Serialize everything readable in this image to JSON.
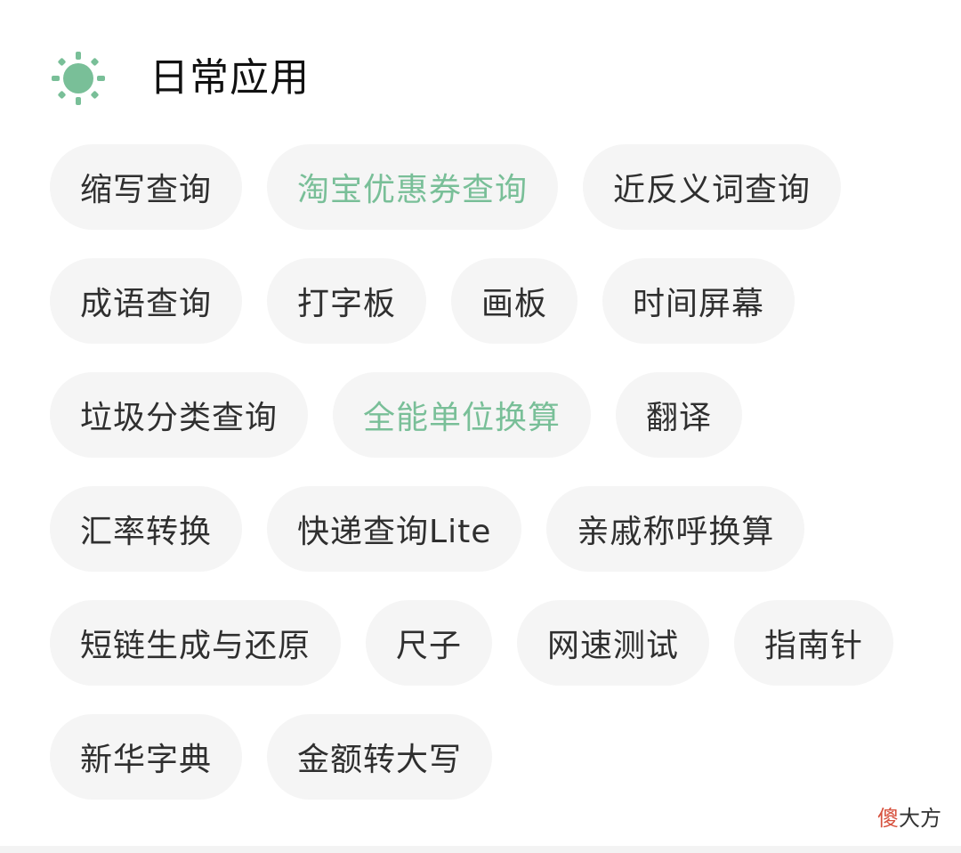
{
  "header": {
    "title": "日常应用",
    "icon": "sun-icon",
    "accent": "#79bf98"
  },
  "tags": [
    [
      "缩写查询",
      "淘宝优惠券查询",
      "近反义词查询"
    ],
    [
      "成语查询",
      "打字板",
      "画板",
      "时间屏幕"
    ],
    [
      "垃圾分类查询",
      "全能单位换算",
      "翻译"
    ],
    [
      "汇率转换",
      "快递查询Lite",
      "亲戚称呼换算"
    ],
    [
      "短链生成与还原",
      "尺子",
      "网速测试",
      "指南针"
    ],
    [
      "新华字典",
      "金额转大写"
    ]
  ],
  "highlighted": [
    "淘宝优惠券查询",
    "全能单位换算"
  ],
  "watermark": {
    "accent_text": "傻",
    "text": "大方",
    "accent_color": "#d7523f"
  }
}
